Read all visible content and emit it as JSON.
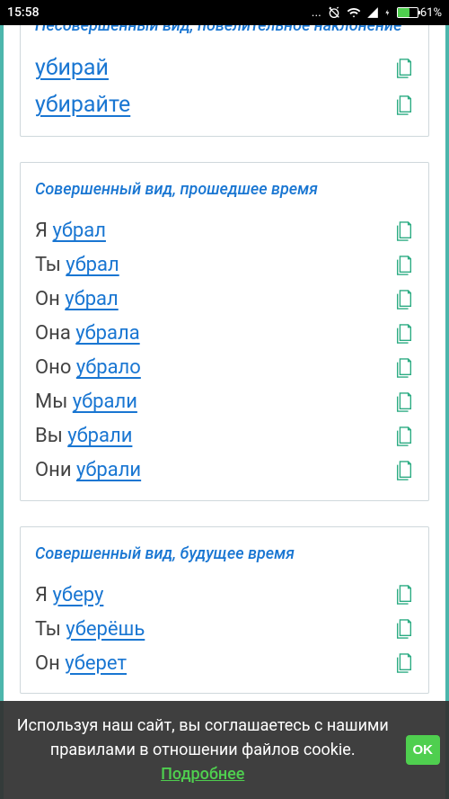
{
  "status": {
    "time": "15:58",
    "battery": "61%"
  },
  "card1": {
    "title": "Несовершенный вид, повелительное наклонение",
    "rows": [
      {
        "pronoun": "",
        "form": "убирай"
      },
      {
        "pronoun": "",
        "form": "убирайте"
      }
    ]
  },
  "card2": {
    "title": "Совершенный вид, прошедшее время",
    "rows": [
      {
        "pronoun": "Я",
        "form": "убрал"
      },
      {
        "pronoun": "Ты",
        "form": "убрал"
      },
      {
        "pronoun": "Он",
        "form": "убрал"
      },
      {
        "pronoun": "Она",
        "form": "убрала"
      },
      {
        "pronoun": "Оно",
        "form": "убрало"
      },
      {
        "pronoun": "Мы",
        "form": "убрали"
      },
      {
        "pronoun": "Вы",
        "form": "убрали"
      },
      {
        "pronoun": "Они",
        "form": "убрали"
      }
    ]
  },
  "card3": {
    "title": "Совершенный вид, будущее время",
    "rows": [
      {
        "pronoun": "Я",
        "form": "уберу"
      },
      {
        "pronoun": "Ты",
        "form": "уберёшь"
      },
      {
        "pronoun": "Он",
        "form": "уберет"
      }
    ]
  },
  "cookie": {
    "text_before": "Используя наш сайт, вы соглашаетесь с нашими правилами в отношении файлов cookie. ",
    "link": "Подробнее",
    "ok": "OK"
  }
}
